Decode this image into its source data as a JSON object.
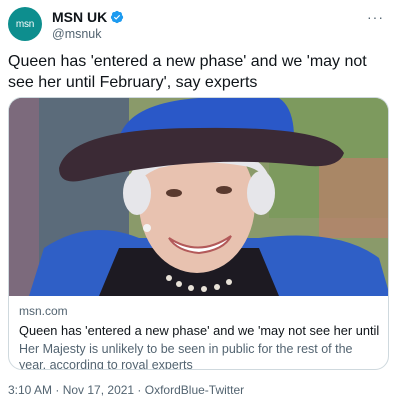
{
  "author": {
    "avatar_text": "msn",
    "display_name": "MSN UK",
    "handle": "@msnuk"
  },
  "more_label": "···",
  "tweet": {
    "text": "Queen has 'entered a new phase' and we 'may not see her until February', say experts"
  },
  "card": {
    "domain": "msn.com",
    "title": "Queen has 'entered a new phase' and we 'may not see her until February', ...",
    "description": "Her Majesty is unlikely to be seen in public for the rest of the year, according to royal experts"
  },
  "meta": {
    "time": "3:10 AM",
    "separator": " · ",
    "date": "Nov 17, 2021",
    "source": "OxfordBlue-Twitter"
  },
  "colors": {
    "avatar_bg": "#0d8e8e",
    "verified": "#1d9bf0",
    "coat_blue": "#2f5fc6",
    "hat_blue": "#2a58c8",
    "hat_brim": "#3b2a35"
  },
  "icons": [
    "msn-logo-icon",
    "verified-badge-icon",
    "more-options-icon"
  ]
}
